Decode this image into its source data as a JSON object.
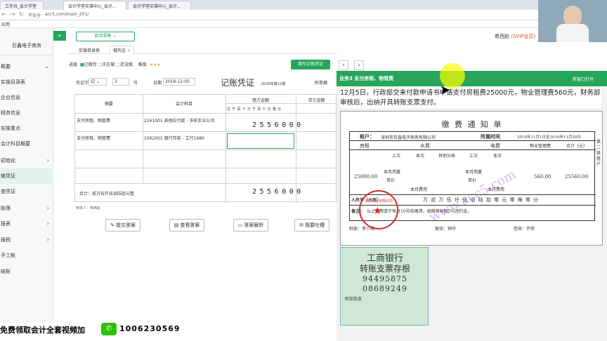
{
  "browser": {
    "tabs": [
      "工作台_会计学堂",
      "会计学堂实操中心_会计...",
      "会计学堂实操中心_会计..."
    ],
    "insecure": "不安全",
    "url": "acc5.com/main_201/",
    "bookmark": "应用"
  },
  "header": {
    "company": "巨鑫电子商务",
    "module": "商贸零售",
    "user": "希西赵",
    "vip": "(SVIP会员)"
  },
  "sidebar": [
    {
      "label": "概要",
      "chevron": "⌄"
    },
    {
      "label": "实操目录表"
    },
    {
      "label": "企业信息"
    },
    {
      "label": "税务信息"
    },
    {
      "label": "实操重点"
    },
    {
      "label": "会计科目概要"
    },
    {
      "label": "初始化",
      "chevron": "›"
    },
    {
      "label": "做凭证"
    },
    {
      "label": "查凭证"
    },
    {
      "label": "账簿",
      "chevron": "›"
    },
    {
      "label": "报表",
      "chevron": "›"
    },
    {
      "label": "报税",
      "chevron": "›"
    },
    {
      "label": "手工帐"
    },
    {
      "label": "结账"
    }
  ],
  "tabs": [
    "实操目录表",
    "做凭证"
  ],
  "progress": {
    "label": "进度:",
    "done": "已做完",
    "doing": "正在做",
    "todo": "还没做",
    "difficulty": "难度:",
    "stars": 3
  },
  "fill_button": "填写记账凭证",
  "voucher": {
    "type_label": "凭证字",
    "type_value": "记",
    "number": "3",
    "number_unit": "号",
    "date_label": "日期",
    "date": "2016-12-05",
    "title": "记账凭证",
    "period": "2016年第12期",
    "attachments": "附单据",
    "headers": {
      "summary": "摘要",
      "account": "会计科目",
      "debit": "借方金额",
      "credit": "贷方金额"
    },
    "units": [
      "亿",
      "千",
      "百",
      "十",
      "万",
      "千",
      "百",
      "十",
      "元",
      "角",
      "分"
    ],
    "rows": [
      {
        "summary": "支付房租、物管费",
        "account": "2241001 其他应付款 - 多彩实业公司",
        "debit": "2556000"
      },
      {
        "summary": "支付房租、物管费",
        "account": "1002001 银行存款 - 工行1980",
        "debit": ""
      }
    ],
    "total_label": "合计：贰万伍仟伍佰陆拾元整",
    "total": "2556000",
    "maker_label": "制单人：希西赵"
  },
  "actions": {
    "submit": "提交答案",
    "view": "查看答案",
    "analysis": "答案解析",
    "complain": "我要吐槽"
  },
  "task": {
    "title": "业务3 支付房租、物管费",
    "new_window": "新窗口打开",
    "description": "12月5日，行政部交来付款申请书申请支付房租费25000元，物业管理费560元，财务部审核后，出纳开具转账支票支付。"
  },
  "notice": {
    "title": "缴 费 通 知 单",
    "tenant_label": "租户：",
    "tenant": "深圳市巨鑫电子商务有限公司",
    "period_label": "所属时间",
    "period": "2016年11月1日至2016年11月30日",
    "rent": "房租",
    "water": "水费",
    "electric": "电费",
    "property_fee": "物业管理费",
    "total_label": "合计（元）",
    "last": "上次",
    "this": "本次",
    "shared": "其他分表",
    "month_usage": "本月用量",
    "unit_price": "单价",
    "month_fee": "本月费用",
    "rent_value": "25000.00",
    "property_value": "560.00",
    "total_value": "25560.00",
    "amount_cn_label": "人民币（大写）",
    "amount_cn": "万  贰  万  伍  仟  伍  佰  陆  拾  零  元  零  角  零  分",
    "note_label": "备注：",
    "note": "以上费用请于每月10号前缴清，逾期将收取5%违约金。",
    "maker_label": "制表：",
    "maker": "李小萌",
    "checker_label": "复核：",
    "checker": "钟华",
    "signer_label": "签收：",
    "signer": "齐荣",
    "side_label": "第二联 租户",
    "stamp": "多彩实业有限公司"
  },
  "cheque": {
    "bank": "工商银行",
    "title": "转账支票存根",
    "number1": "94495875",
    "number2": "08689249",
    "extra": "附加信息",
    "watermark": "www.acc5.com"
  },
  "footer": {
    "promo": "免费领取会计全套视频加",
    "qq": "1006230569"
  },
  "colors": {
    "brand": "#26a65b",
    "vip": "#e04b1a"
  }
}
